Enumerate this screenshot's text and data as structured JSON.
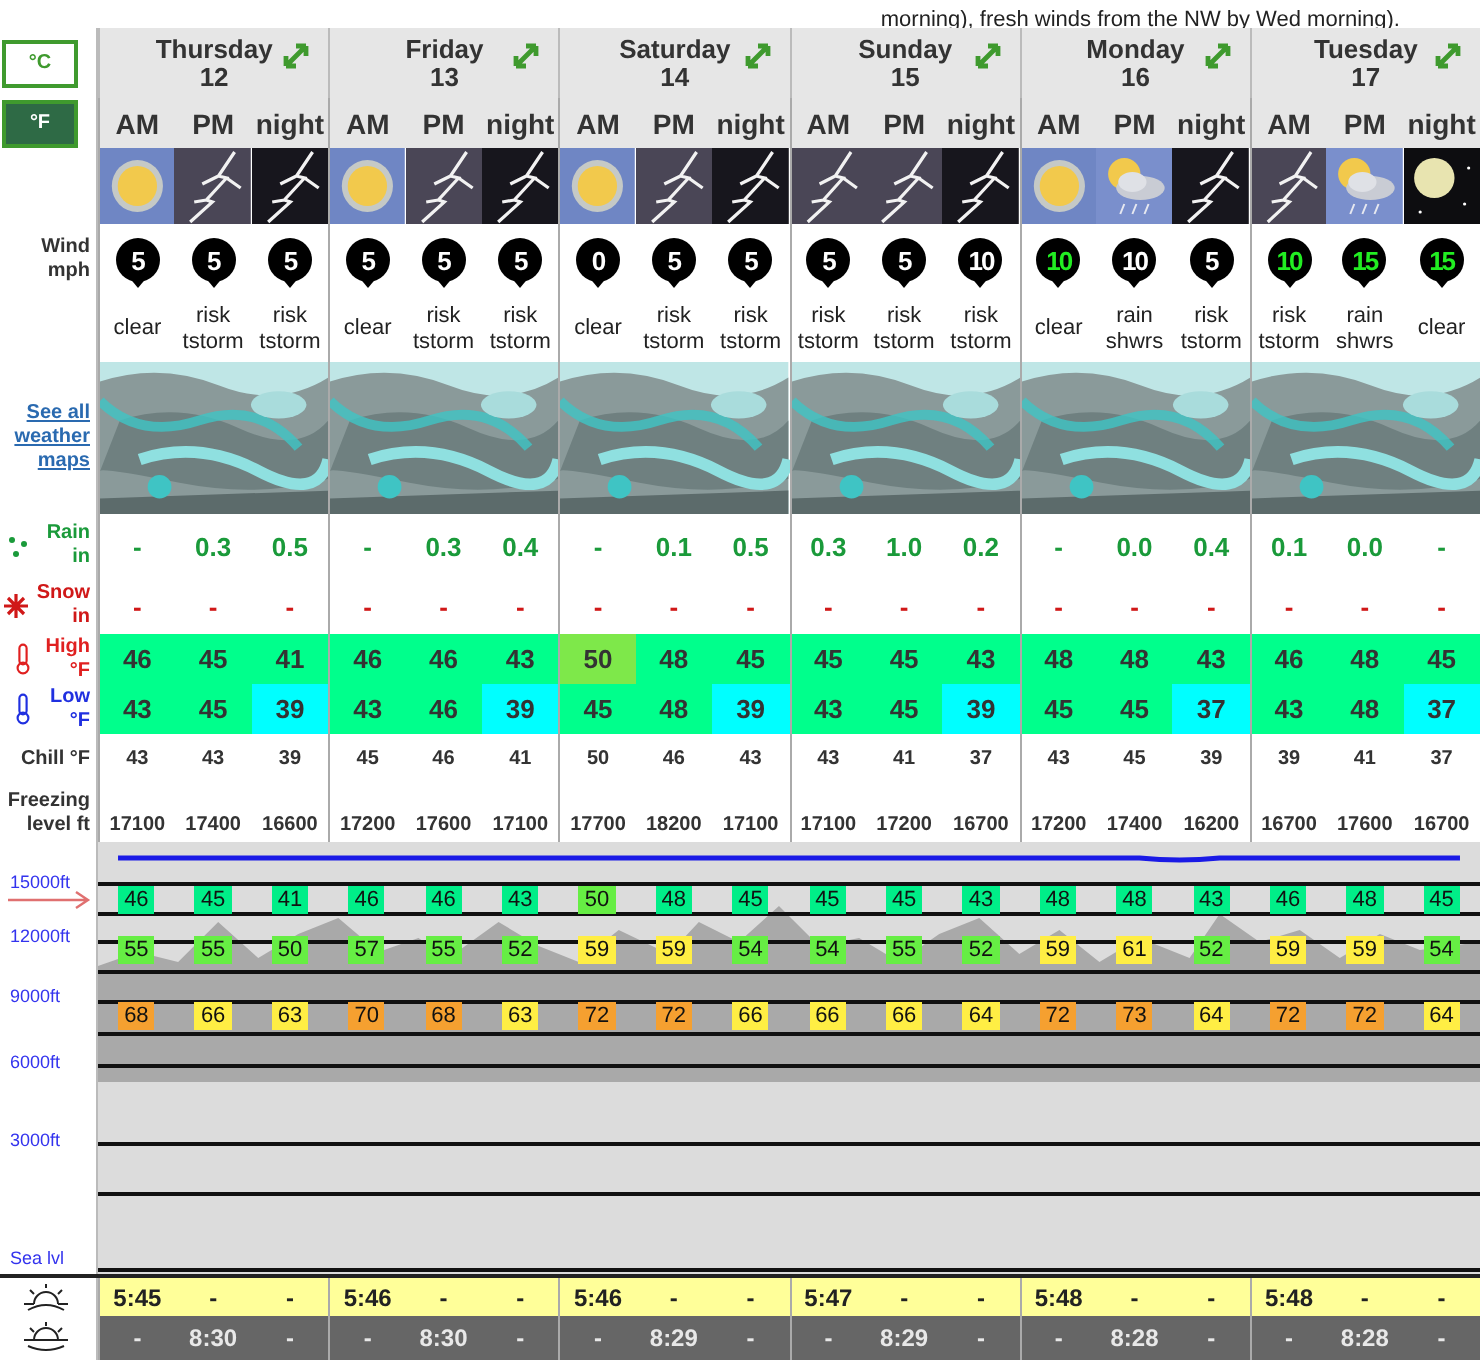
{
  "forecast_note": "morning), fresh winds from the NW by Wed morning).",
  "units": [
    {
      "label": "°C",
      "selected": false
    },
    {
      "label": "°F",
      "selected": true
    }
  ],
  "maps_link": "See all weather maps",
  "labels": {
    "wind": "Wind mph",
    "rain": "Rain in",
    "snow": "Snow in",
    "high": "High °F",
    "low": "Low °F",
    "chill": "Chill °F",
    "freezing": "Freezing level ft"
  },
  "altitude_labels": [
    "15000ft",
    "12000ft",
    "9000ft",
    "6000ft",
    "3000ft",
    "Sea lvl"
  ],
  "days": [
    {
      "day": "Thursday",
      "date": "12",
      "periods": [
        {
          "label": "AM",
          "kind": "sun",
          "wind": {
            "speed": "5",
            "strong": false
          },
          "summary": "clear",
          "rain": "-",
          "snow": "-",
          "high": {
            "value": "46",
            "color": "#00ff8c"
          },
          "low": {
            "value": "43",
            "color": "#00ff8c"
          },
          "chill": "43",
          "freezing": "17100",
          "alt": [
            {
              "value": "46",
              "color": "#00ee88"
            },
            {
              "value": "55",
              "color": "#66ee44"
            },
            {
              "value": "68",
              "color": "#f5a030"
            }
          ],
          "sunrise": "5:45",
          "sunset": "-"
        },
        {
          "label": "PM",
          "kind": "storm",
          "wind": {
            "speed": "5",
            "strong": false
          },
          "summary": "risk tstorm",
          "rain": "0.3",
          "snow": "-",
          "high": {
            "value": "45",
            "color": "#00ff8c"
          },
          "low": {
            "value": "45",
            "color": "#00ff8c"
          },
          "chill": "43",
          "freezing": "17400",
          "alt": [
            {
              "value": "45",
              "color": "#00ee88"
            },
            {
              "value": "55",
              "color": "#66ee44"
            },
            {
              "value": "66",
              "color": "#ffee44"
            }
          ],
          "sunrise": "-",
          "sunset": "8:30"
        },
        {
          "label": "night",
          "kind": "storm_night",
          "wind": {
            "speed": "5",
            "strong": false
          },
          "summary": "risk tstorm",
          "rain": "0.5",
          "snow": "-",
          "high": {
            "value": "41",
            "color": "#00ff8c"
          },
          "low": {
            "value": "39",
            "color": "#00ffff"
          },
          "chill": "39",
          "freezing": "16600",
          "alt": [
            {
              "value": "41",
              "color": "#00ee88"
            },
            {
              "value": "50",
              "color": "#66ee44"
            },
            {
              "value": "63",
              "color": "#ffee44"
            }
          ],
          "sunrise": "-",
          "sunset": "-"
        }
      ]
    },
    {
      "day": "Friday",
      "date": "13",
      "periods": [
        {
          "label": "AM",
          "kind": "sun",
          "wind": {
            "speed": "5",
            "strong": false
          },
          "summary": "clear",
          "rain": "-",
          "snow": "-",
          "high": {
            "value": "46",
            "color": "#00ff8c"
          },
          "low": {
            "value": "43",
            "color": "#00ff8c"
          },
          "chill": "45",
          "freezing": "17200",
          "alt": [
            {
              "value": "46",
              "color": "#00ee88"
            },
            {
              "value": "57",
              "color": "#66ee44"
            },
            {
              "value": "70",
              "color": "#f5a030"
            }
          ],
          "sunrise": "5:46",
          "sunset": "-"
        },
        {
          "label": "PM",
          "kind": "storm",
          "wind": {
            "speed": "5",
            "strong": false
          },
          "summary": "risk tstorm",
          "rain": "0.3",
          "snow": "-",
          "high": {
            "value": "46",
            "color": "#00ff8c"
          },
          "low": {
            "value": "46",
            "color": "#00ff8c"
          },
          "chill": "46",
          "freezing": "17600",
          "alt": [
            {
              "value": "46",
              "color": "#00ee88"
            },
            {
              "value": "55",
              "color": "#66ee44"
            },
            {
              "value": "68",
              "color": "#f5a030"
            }
          ],
          "sunrise": "-",
          "sunset": "8:30"
        },
        {
          "label": "night",
          "kind": "storm_night",
          "wind": {
            "speed": "5",
            "strong": false
          },
          "summary": "risk tstorm",
          "rain": "0.4",
          "snow": "-",
          "high": {
            "value": "43",
            "color": "#00ff8c"
          },
          "low": {
            "value": "39",
            "color": "#00ffff"
          },
          "chill": "41",
          "freezing": "17100",
          "alt": [
            {
              "value": "43",
              "color": "#00ee88"
            },
            {
              "value": "52",
              "color": "#66ee44"
            },
            {
              "value": "63",
              "color": "#ffee44"
            }
          ],
          "sunrise": "-",
          "sunset": "-"
        }
      ]
    },
    {
      "day": "Saturday",
      "date": "14",
      "periods": [
        {
          "label": "AM",
          "kind": "sun",
          "wind": {
            "speed": "0",
            "strong": false
          },
          "summary": "clear",
          "rain": "-",
          "snow": "-",
          "high": {
            "value": "50",
            "color": "#7ee84a"
          },
          "low": {
            "value": "45",
            "color": "#00ff8c"
          },
          "chill": "50",
          "freezing": "17700",
          "alt": [
            {
              "value": "50",
              "color": "#66ee44"
            },
            {
              "value": "59",
              "color": "#ffee44"
            },
            {
              "value": "72",
              "color": "#f5a030"
            }
          ],
          "sunrise": "5:46",
          "sunset": "-"
        },
        {
          "label": "PM",
          "kind": "storm",
          "wind": {
            "speed": "5",
            "strong": false
          },
          "summary": "risk tstorm",
          "rain": "0.1",
          "snow": "-",
          "high": {
            "value": "48",
            "color": "#00ff8c"
          },
          "low": {
            "value": "48",
            "color": "#00ff8c"
          },
          "chill": "46",
          "freezing": "18200",
          "alt": [
            {
              "value": "48",
              "color": "#00ee88"
            },
            {
              "value": "59",
              "color": "#ffee44"
            },
            {
              "value": "72",
              "color": "#f5a030"
            }
          ],
          "sunrise": "-",
          "sunset": "8:29"
        },
        {
          "label": "night",
          "kind": "storm_night",
          "wind": {
            "speed": "5",
            "strong": false
          },
          "summary": "risk tstorm",
          "rain": "0.5",
          "snow": "-",
          "high": {
            "value": "45",
            "color": "#00ff8c"
          },
          "low": {
            "value": "39",
            "color": "#00ffff"
          },
          "chill": "43",
          "freezing": "17100",
          "alt": [
            {
              "value": "45",
              "color": "#00ee88"
            },
            {
              "value": "54",
              "color": "#66ee44"
            },
            {
              "value": "66",
              "color": "#ffee44"
            }
          ],
          "sunrise": "-",
          "sunset": "-"
        }
      ]
    },
    {
      "day": "Sunday",
      "date": "15",
      "periods": [
        {
          "label": "AM",
          "kind": "storm",
          "wind": {
            "speed": "5",
            "strong": false
          },
          "summary": "risk tstorm",
          "rain": "0.3",
          "snow": "-",
          "high": {
            "value": "45",
            "color": "#00ff8c"
          },
          "low": {
            "value": "43",
            "color": "#00ff8c"
          },
          "chill": "43",
          "freezing": "17100",
          "alt": [
            {
              "value": "45",
              "color": "#00ee88"
            },
            {
              "value": "54",
              "color": "#66ee44"
            },
            {
              "value": "66",
              "color": "#ffee44"
            }
          ],
          "sunrise": "5:47",
          "sunset": "-"
        },
        {
          "label": "PM",
          "kind": "storm",
          "wind": {
            "speed": "5",
            "strong": false
          },
          "summary": "risk tstorm",
          "rain": "1.0",
          "snow": "-",
          "high": {
            "value": "45",
            "color": "#00ff8c"
          },
          "low": {
            "value": "45",
            "color": "#00ff8c"
          },
          "chill": "41",
          "freezing": "17200",
          "alt": [
            {
              "value": "45",
              "color": "#00ee88"
            },
            {
              "value": "55",
              "color": "#66ee44"
            },
            {
              "value": "66",
              "color": "#ffee44"
            }
          ],
          "sunrise": "-",
          "sunset": "8:29"
        },
        {
          "label": "night",
          "kind": "storm_night",
          "wind": {
            "speed": "10",
            "strong": false
          },
          "summary": "risk tstorm",
          "rain": "0.2",
          "snow": "-",
          "high": {
            "value": "43",
            "color": "#00ff8c"
          },
          "low": {
            "value": "39",
            "color": "#00ffff"
          },
          "chill": "37",
          "freezing": "16700",
          "alt": [
            {
              "value": "43",
              "color": "#00ee88"
            },
            {
              "value": "52",
              "color": "#66ee44"
            },
            {
              "value": "64",
              "color": "#ffee44"
            }
          ],
          "sunrise": "-",
          "sunset": "-"
        }
      ]
    },
    {
      "day": "Monday",
      "date": "16",
      "periods": [
        {
          "label": "AM",
          "kind": "sun",
          "wind": {
            "speed": "10",
            "strong": true
          },
          "summary": "clear",
          "rain": "-",
          "snow": "-",
          "high": {
            "value": "48",
            "color": "#00ff8c"
          },
          "low": {
            "value": "45",
            "color": "#00ff8c"
          },
          "chill": "43",
          "freezing": "17200",
          "alt": [
            {
              "value": "48",
              "color": "#00ee88"
            },
            {
              "value": "59",
              "color": "#ffee44"
            },
            {
              "value": "72",
              "color": "#f5a030"
            }
          ],
          "sunrise": "5:48",
          "sunset": "-"
        },
        {
          "label": "PM",
          "kind": "sun_cloud_rain",
          "wind": {
            "speed": "10",
            "strong": false
          },
          "summary": "rain shwrs",
          "rain": "0.0",
          "snow": "-",
          "high": {
            "value": "48",
            "color": "#00ff8c"
          },
          "low": {
            "value": "45",
            "color": "#00ff8c"
          },
          "chill": "45",
          "freezing": "17400",
          "alt": [
            {
              "value": "48",
              "color": "#00ee88"
            },
            {
              "value": "61",
              "color": "#ffee44"
            },
            {
              "value": "73",
              "color": "#f5a030"
            }
          ],
          "sunrise": "-",
          "sunset": "8:28"
        },
        {
          "label": "night",
          "kind": "storm_night",
          "wind": {
            "speed": "5",
            "strong": false
          },
          "summary": "risk tstorm",
          "rain": "0.4",
          "snow": "-",
          "high": {
            "value": "43",
            "color": "#00ff8c"
          },
          "low": {
            "value": "37",
            "color": "#00ffff"
          },
          "chill": "39",
          "freezing": "16200",
          "alt": [
            {
              "value": "43",
              "color": "#00ee88"
            },
            {
              "value": "52",
              "color": "#66ee44"
            },
            {
              "value": "64",
              "color": "#ffee44"
            }
          ],
          "sunrise": "-",
          "sunset": "-"
        }
      ]
    },
    {
      "day": "Tuesday",
      "date": "17",
      "periods": [
        {
          "label": "AM",
          "kind": "storm",
          "wind": {
            "speed": "10",
            "strong": true
          },
          "summary": "risk tstorm",
          "rain": "0.1",
          "snow": "-",
          "high": {
            "value": "46",
            "color": "#00ff8c"
          },
          "low": {
            "value": "43",
            "color": "#00ff8c"
          },
          "chill": "39",
          "freezing": "16700",
          "alt": [
            {
              "value": "46",
              "color": "#00ee88"
            },
            {
              "value": "59",
              "color": "#ffee44"
            },
            {
              "value": "72",
              "color": "#f5a030"
            }
          ],
          "sunrise": "5:48",
          "sunset": "-"
        },
        {
          "label": "PM",
          "kind": "sun_cloud_rain",
          "wind": {
            "speed": "15",
            "strong": true
          },
          "summary": "rain shwrs",
          "rain": "0.0",
          "snow": "-",
          "high": {
            "value": "48",
            "color": "#00ff8c"
          },
          "low": {
            "value": "48",
            "color": "#00ff8c"
          },
          "chill": "41",
          "freezing": "17600",
          "alt": [
            {
              "value": "48",
              "color": "#00ee88"
            },
            {
              "value": "59",
              "color": "#ffee44"
            },
            {
              "value": "72",
              "color": "#f5a030"
            }
          ],
          "sunrise": "-",
          "sunset": "8:28"
        },
        {
          "label": "night",
          "kind": "moon",
          "wind": {
            "speed": "15",
            "strong": true
          },
          "summary": "clear",
          "rain": "-",
          "snow": "-",
          "high": {
            "value": "45",
            "color": "#00ff8c"
          },
          "low": {
            "value": "37",
            "color": "#00ffff"
          },
          "chill": "37",
          "freezing": "16700",
          "alt": [
            {
              "value": "45",
              "color": "#00ee88"
            },
            {
              "value": "54",
              "color": "#66ee44"
            },
            {
              "value": "64",
              "color": "#ffee44"
            }
          ],
          "sunrise": "-",
          "sunset": "-"
        }
      ]
    }
  ]
}
